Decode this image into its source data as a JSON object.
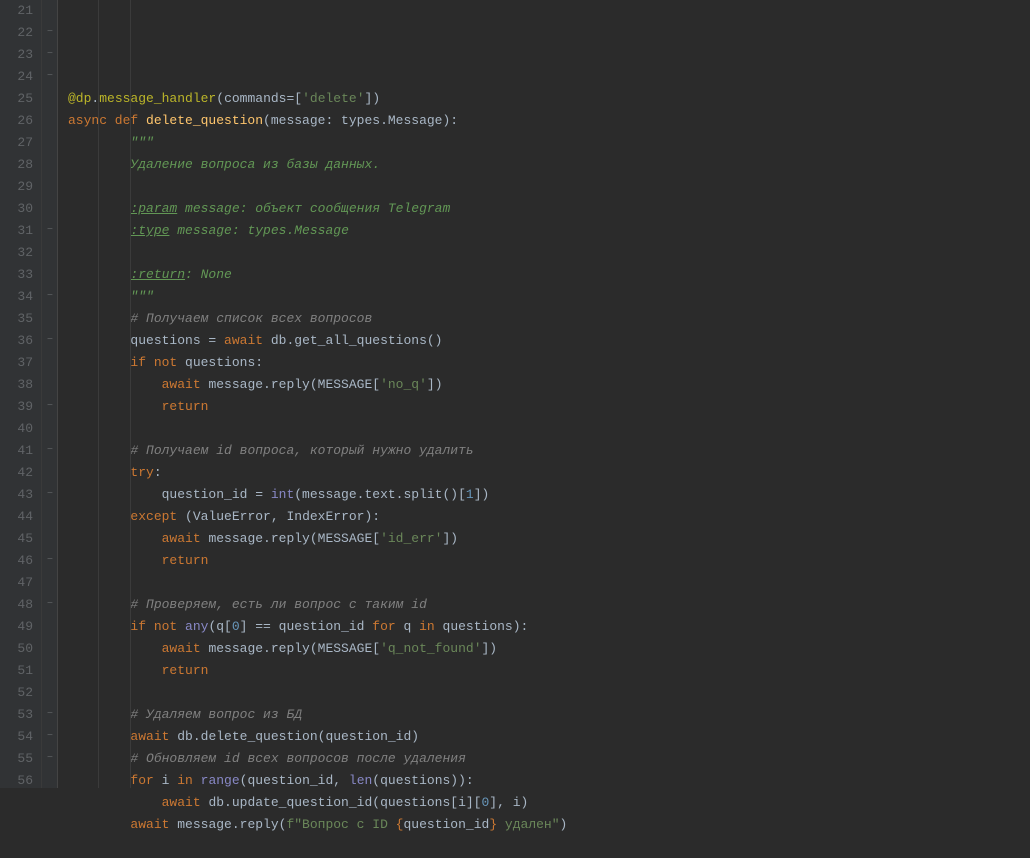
{
  "lines": [
    {
      "n": 21,
      "indent": 0,
      "fold": "",
      "tokens": []
    },
    {
      "n": 22,
      "indent": 0,
      "fold": "⊟",
      "tokens": [
        {
          "c": "decor",
          "t": "@dp"
        },
        {
          "c": "punc",
          "t": "."
        },
        {
          "c": "decor",
          "t": "message_handler"
        },
        {
          "c": "punc",
          "t": "("
        },
        {
          "c": "param",
          "t": "commands"
        },
        {
          "c": "punc",
          "t": "=["
        },
        {
          "c": "str",
          "t": "'delete'"
        },
        {
          "c": "punc",
          "t": "])"
        }
      ]
    },
    {
      "n": 23,
      "indent": 0,
      "fold": "⊟",
      "tokens": [
        {
          "c": "kw",
          "t": "async def "
        },
        {
          "c": "fn",
          "t": "delete_question"
        },
        {
          "c": "punc",
          "t": "(message: types.Message):"
        }
      ]
    },
    {
      "n": 24,
      "indent": 2,
      "fold": "⊟",
      "tokens": [
        {
          "c": "doc",
          "t": "\"\"\""
        }
      ]
    },
    {
      "n": 25,
      "indent": 2,
      "fold": "",
      "tokens": [
        {
          "c": "doc",
          "t": "Удаление вопроса из базы данных."
        }
      ]
    },
    {
      "n": 26,
      "indent": 2,
      "fold": "",
      "tokens": []
    },
    {
      "n": 27,
      "indent": 2,
      "fold": "",
      "tokens": [
        {
          "c": "doc docunder",
          "t": ":param"
        },
        {
          "c": "doc",
          "t": " message: объект сообщения Telegram"
        }
      ]
    },
    {
      "n": 28,
      "indent": 2,
      "fold": "",
      "tokens": [
        {
          "c": "doc docunder",
          "t": ":type"
        },
        {
          "c": "doc",
          "t": " message: types.Message"
        }
      ]
    },
    {
      "n": 29,
      "indent": 2,
      "fold": "",
      "tokens": []
    },
    {
      "n": 30,
      "indent": 2,
      "fold": "",
      "tokens": [
        {
          "c": "doc docunder",
          "t": ":return"
        },
        {
          "c": "doc",
          "t": ": None"
        }
      ]
    },
    {
      "n": 31,
      "indent": 2,
      "fold": "⊡",
      "tokens": [
        {
          "c": "doc",
          "t": "\"\"\""
        }
      ]
    },
    {
      "n": 32,
      "indent": 2,
      "fold": "",
      "tokens": [
        {
          "c": "cmt",
          "t": "# Получаем список всех вопросов"
        }
      ]
    },
    {
      "n": 33,
      "indent": 2,
      "fold": "",
      "tokens": [
        {
          "c": "punc",
          "t": "questions = "
        },
        {
          "c": "kw",
          "t": "await "
        },
        {
          "c": "punc",
          "t": "db.get_all_questions()"
        }
      ]
    },
    {
      "n": 34,
      "indent": 2,
      "fold": "⊟",
      "tokens": [
        {
          "c": "kw",
          "t": "if not "
        },
        {
          "c": "punc",
          "t": "questions:"
        }
      ]
    },
    {
      "n": 35,
      "indent": 3,
      "fold": "",
      "tokens": [
        {
          "c": "kw",
          "t": "await "
        },
        {
          "c": "punc",
          "t": "message.reply(MESSAGE["
        },
        {
          "c": "str",
          "t": "'no_q'"
        },
        {
          "c": "punc",
          "t": "])"
        }
      ]
    },
    {
      "n": 36,
      "indent": 3,
      "fold": "⊡",
      "tokens": [
        {
          "c": "kw",
          "t": "return"
        }
      ]
    },
    {
      "n": 37,
      "indent": 2,
      "fold": "",
      "tokens": []
    },
    {
      "n": 38,
      "indent": 2,
      "fold": "",
      "tokens": [
        {
          "c": "cmt",
          "t": "# Получаем id вопроса, который нужно удалить"
        }
      ]
    },
    {
      "n": 39,
      "indent": 2,
      "fold": "⊟",
      "tokens": [
        {
          "c": "kw",
          "t": "try"
        },
        {
          "c": "punc",
          "t": ":"
        }
      ]
    },
    {
      "n": 40,
      "indent": 3,
      "fold": "",
      "tokens": [
        {
          "c": "punc",
          "t": "question_id = "
        },
        {
          "c": "builtin",
          "t": "int"
        },
        {
          "c": "punc",
          "t": "(message.text.split()["
        },
        {
          "c": "num",
          "t": "1"
        },
        {
          "c": "punc",
          "t": "])"
        }
      ]
    },
    {
      "n": 41,
      "indent": 2,
      "fold": "⊟",
      "tokens": [
        {
          "c": "kw",
          "t": "except "
        },
        {
          "c": "punc",
          "t": "("
        },
        {
          "c": "type",
          "t": "ValueError"
        },
        {
          "c": "punc",
          "t": ", "
        },
        {
          "c": "type",
          "t": "IndexError"
        },
        {
          "c": "punc",
          "t": "):"
        }
      ]
    },
    {
      "n": 42,
      "indent": 3,
      "fold": "",
      "tokens": [
        {
          "c": "kw",
          "t": "await "
        },
        {
          "c": "punc",
          "t": "message.reply(MESSAGE["
        },
        {
          "c": "str",
          "t": "'id_err'"
        },
        {
          "c": "punc",
          "t": "])"
        }
      ]
    },
    {
      "n": 43,
      "indent": 3,
      "fold": "⊡",
      "tokens": [
        {
          "c": "kw",
          "t": "return"
        }
      ]
    },
    {
      "n": 44,
      "indent": 2,
      "fold": "",
      "tokens": []
    },
    {
      "n": 45,
      "indent": 2,
      "fold": "",
      "tokens": [
        {
          "c": "cmt",
          "t": "# Проверяем, есть ли вопрос с таким id"
        }
      ]
    },
    {
      "n": 46,
      "indent": 2,
      "fold": "⊟",
      "tokens": [
        {
          "c": "kw",
          "t": "if not "
        },
        {
          "c": "builtin",
          "t": "any"
        },
        {
          "c": "punc",
          "t": "(q["
        },
        {
          "c": "num",
          "t": "0"
        },
        {
          "c": "punc",
          "t": "] == question_id "
        },
        {
          "c": "kw",
          "t": "for "
        },
        {
          "c": "punc",
          "t": "q "
        },
        {
          "c": "kw",
          "t": "in "
        },
        {
          "c": "punc",
          "t": "questions):"
        }
      ]
    },
    {
      "n": 47,
      "indent": 3,
      "fold": "",
      "tokens": [
        {
          "c": "kw",
          "t": "await "
        },
        {
          "c": "punc",
          "t": "message.reply(MESSAGE["
        },
        {
          "c": "str",
          "t": "'q_not_found'"
        },
        {
          "c": "punc",
          "t": "])"
        }
      ]
    },
    {
      "n": 48,
      "indent": 3,
      "fold": "⊡",
      "tokens": [
        {
          "c": "kw",
          "t": "return"
        }
      ]
    },
    {
      "n": 49,
      "indent": 2,
      "fold": "",
      "tokens": []
    },
    {
      "n": 50,
      "indent": 2,
      "fold": "",
      "tokens": [
        {
          "c": "cmt",
          "t": "# Удаляем вопрос из БД"
        }
      ]
    },
    {
      "n": 51,
      "indent": 2,
      "fold": "",
      "tokens": [
        {
          "c": "kw",
          "t": "await "
        },
        {
          "c": "punc",
          "t": "db.delete_question(question_id)"
        }
      ]
    },
    {
      "n": 52,
      "indent": 2,
      "fold": "",
      "tokens": [
        {
          "c": "cmt",
          "t": "# Обновляем id всех вопросов после удаления"
        }
      ]
    },
    {
      "n": 53,
      "indent": 2,
      "fold": "⊟",
      "tokens": [
        {
          "c": "kw",
          "t": "for "
        },
        {
          "c": "punc",
          "t": "i "
        },
        {
          "c": "kw",
          "t": "in "
        },
        {
          "c": "builtin",
          "t": "range"
        },
        {
          "c": "punc",
          "t": "(question_id, "
        },
        {
          "c": "builtin",
          "t": "len"
        },
        {
          "c": "punc",
          "t": "(questions)):"
        }
      ]
    },
    {
      "n": 54,
      "indent": 3,
      "fold": "⊡",
      "tokens": [
        {
          "c": "kw",
          "t": "await "
        },
        {
          "c": "punc",
          "t": "db.update_question_id(questions[i]["
        },
        {
          "c": "num",
          "t": "0"
        },
        {
          "c": "punc",
          "t": "], i)"
        }
      ]
    },
    {
      "n": 55,
      "indent": 2,
      "fold": "⊡",
      "tokens": [
        {
          "c": "kw",
          "t": "await "
        },
        {
          "c": "punc",
          "t": "message.reply("
        },
        {
          "c": "str",
          "t": "f\"Вопрос с ID "
        },
        {
          "c": "brace",
          "t": "{"
        },
        {
          "c": "fstr-expr",
          "t": "question_id"
        },
        {
          "c": "brace",
          "t": "}"
        },
        {
          "c": "str",
          "t": " удален\""
        },
        {
          "c": "punc",
          "t": ")"
        }
      ]
    },
    {
      "n": 56,
      "indent": 0,
      "fold": "",
      "tokens": []
    }
  ],
  "indentUnit": "    "
}
